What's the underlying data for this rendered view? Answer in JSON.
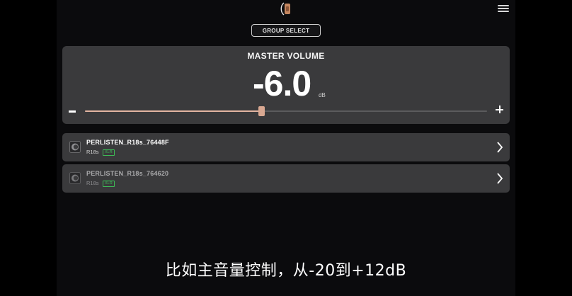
{
  "header": {
    "logo_icon": "perlisten-logo-icon",
    "menu_icon": "hamburger-menu-icon"
  },
  "group_select": {
    "label": "GROUP SELECT"
  },
  "master": {
    "title": "MASTER VOLUME",
    "value": "-6.0",
    "unit": "dB",
    "slider": {
      "min": -20,
      "max": 12,
      "value": -6.0
    },
    "accent_color": "#d9a892"
  },
  "devices": [
    {
      "name": "PERLISTEN_R18s_76448F",
      "model": "R18s",
      "badge": "XLR",
      "active": true
    },
    {
      "name": "PERLISTEN_R18s_764620",
      "model": "R18s",
      "badge": "XLR",
      "active": false
    }
  ],
  "subtitle": "比如主音量控制，从-20到+12dB"
}
